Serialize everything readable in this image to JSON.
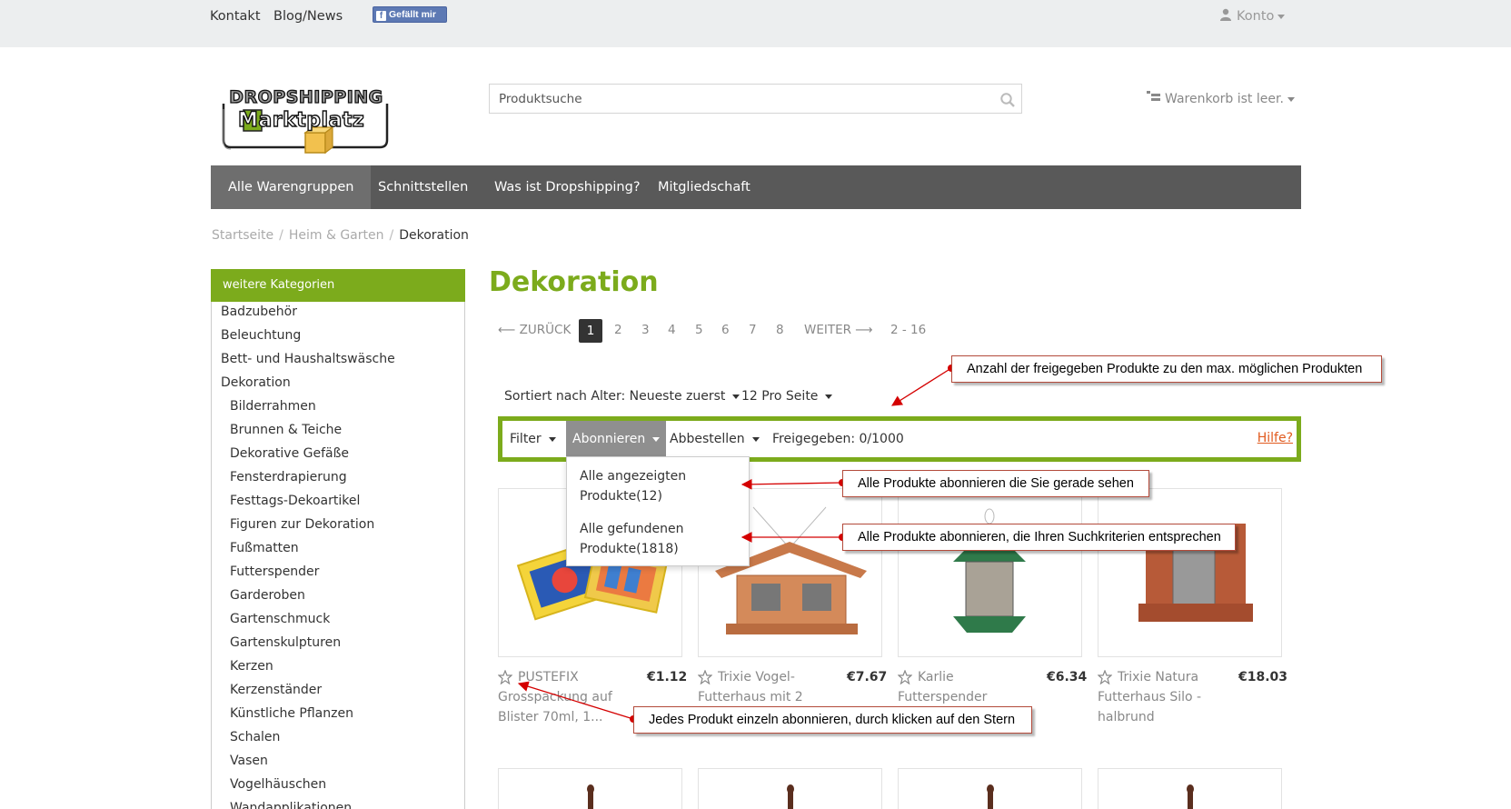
{
  "topbar": {
    "links": [
      "Kontakt",
      "Blog/News"
    ],
    "fb_like": "Gefällt mir",
    "konto": "Konto"
  },
  "header": {
    "logo_text_top": "DROPSHIPPING",
    "logo_text_bottom": "Marktplatz",
    "search_placeholder": "Produktsuche",
    "cart": "Warenkorb ist leer."
  },
  "nav": {
    "items": [
      "Alle Warengruppen",
      "Schnittstellen",
      "Was ist Dropshipping?",
      "Mitgliedschaft"
    ]
  },
  "breadcrumb": {
    "items": [
      "Startseite",
      "Heim & Garten",
      "Dekoration"
    ],
    "separator": "/"
  },
  "sidebar": {
    "title": "weitere Kategorien",
    "categories": [
      "Badzubehör",
      "Beleuchtung",
      "Bett- und Haushaltswäsche",
      "Dekoration"
    ],
    "subcategories": [
      "Bilderrahmen",
      "Brunnen & Teiche",
      "Dekorative Gefäße",
      "Fensterdrapierung",
      "Festtags-Dekoartikel",
      "Figuren zur Dekoration",
      "Fußmatten",
      "Futterspender",
      "Garderoben",
      "Gartenschmuck",
      "Gartenskulpturen",
      "Kerzen",
      "Kerzenständer",
      "Künstliche Pflanzen",
      "Schalen",
      "Vasen",
      "Vogelhäuschen",
      "Wandapplikationen"
    ]
  },
  "main": {
    "title": "Dekoration",
    "pagination": {
      "prev": "⟵ ZURÜCK",
      "pages": [
        "1",
        "2",
        "3",
        "4",
        "5",
        "6",
        "7",
        "8"
      ],
      "current": "1",
      "next": "WEITER ⟶",
      "range": "2 - 16"
    },
    "sort": {
      "label": "Sortiert nach Alter: Neueste zuerst",
      "per_page": "12 Pro Seite"
    },
    "filterbar": {
      "filter": "Filter",
      "abonnieren": "Abonnieren",
      "abbestellen": "Abbestellen",
      "freigegeben": "Freigegeben: 0/1000",
      "hilfe": "Hilfe?"
    },
    "dropdown": {
      "items": [
        "Alle angezeigten Produkte(12)",
        "Alle gefundenen Produkte(1818)"
      ]
    },
    "products": [
      {
        "title": "PUSTEFIX Grosspackung auf Blister 70ml, 1...",
        "price": "€1.12"
      },
      {
        "title": "Trixie Vogel-Futterhaus mit 2",
        "price": "€7.67"
      },
      {
        "title": "Karlie Futterspender",
        "price": "€6.34"
      },
      {
        "title": "Trixie Natura Futterhaus Silo - halbrund",
        "price": "€18.03"
      }
    ]
  },
  "annotations": [
    "Anzahl der freigegeben Produkte zu den max. möglichen Produkten",
    "Alle Produkte abonnieren die Sie gerade sehen",
    "Alle Produkte abonnieren, die Ihren Suchkriterien entsprechen",
    "Jedes Produkt einzeln abonnieren, durch klicken auf den Stern"
  ],
  "colors": {
    "accent_green": "#7cab1c",
    "nav_bg": "#595959",
    "annotation_red": "#d40000",
    "hilfe_orange": "#e15a1e"
  }
}
